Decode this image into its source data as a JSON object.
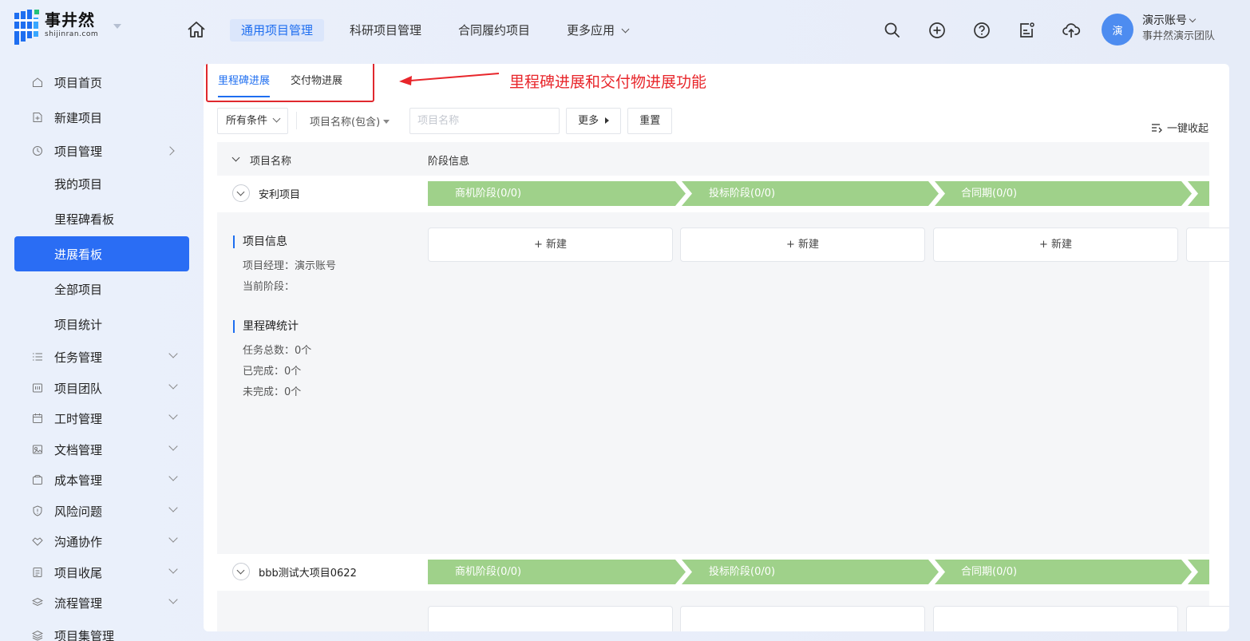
{
  "brand": {
    "name": "事井然",
    "domain": "shijinran.com",
    "color": "#1e6ef0"
  },
  "nav": [
    {
      "label": "通用项目管理",
      "active": true
    },
    {
      "label": "科研项目管理",
      "active": false
    },
    {
      "label": "合同履约项目",
      "active": false
    },
    {
      "label": "更多应用",
      "active": false
    }
  ],
  "header_icons": [
    "search-icon",
    "add-circle-icon",
    "help-icon",
    "notice-icon",
    "cloud-upload-icon"
  ],
  "user": {
    "avatar_text": "演",
    "name": "演示账号",
    "team": "事井然演示团队"
  },
  "sidebar": {
    "items": [
      {
        "label": "项目首页",
        "icon": "home-icon"
      },
      {
        "label": "新建项目",
        "icon": "new-file-icon"
      },
      {
        "label": "项目管理",
        "icon": "clock-icon"
      },
      {
        "label": "我的项目"
      },
      {
        "label": "里程碑看板"
      },
      {
        "label": "进展看板",
        "active": true
      },
      {
        "label": "全部项目"
      },
      {
        "label": "项目统计"
      },
      {
        "label": "任务管理",
        "icon": "list-icon"
      },
      {
        "label": "项目团队",
        "icon": "team-icon"
      },
      {
        "label": "工时管理",
        "icon": "calendar-icon"
      },
      {
        "label": "文档管理",
        "icon": "document-icon"
      },
      {
        "label": "成本管理",
        "icon": "wallet-icon"
      },
      {
        "label": "风险问题",
        "icon": "shield-icon"
      },
      {
        "label": "沟通协作",
        "icon": "handshake-icon"
      },
      {
        "label": "项目收尾",
        "icon": "checklist-icon"
      },
      {
        "label": "流程管理",
        "icon": "layers-icon"
      },
      {
        "label": "项目集管理",
        "icon": "stack-icon"
      }
    ]
  },
  "tabs": [
    {
      "label": "里程碑进展",
      "active": true
    },
    {
      "label": "交付物进展",
      "active": false
    }
  ],
  "annotation": {
    "text": "里程碑进展和交付物进展功能",
    "color": "#e8262b"
  },
  "filters": {
    "condition": "所有条件",
    "field": "项目名称(包含)",
    "search_placeholder": "项目名称",
    "more_label": "更多",
    "reset_label": "重置",
    "collapse_label": "一键收起"
  },
  "table": {
    "col_name": "项目名称",
    "col_stage": "阶段信息",
    "stage_color": "#9fd18a",
    "projects": [
      {
        "name": "安利项目",
        "stages": [
          "商机阶段(0/0)",
          "投标阶段(0/0)",
          "合同期(0/0)"
        ],
        "info_title": "项目信息",
        "manager": "项目经理：演示账号",
        "current_stage": "当前阶段：",
        "milestone_title": "里程碑统计",
        "task_total": "任务总数：0个",
        "completed": "已完成：0个",
        "uncompleted": "未完成：0个",
        "new_label": "+ 新建"
      },
      {
        "name": "bbb测试大项目0622",
        "stages": [
          "商机阶段(0/0)",
          "投标阶段(0/0)",
          "合同期(0/0)"
        ]
      }
    ]
  }
}
